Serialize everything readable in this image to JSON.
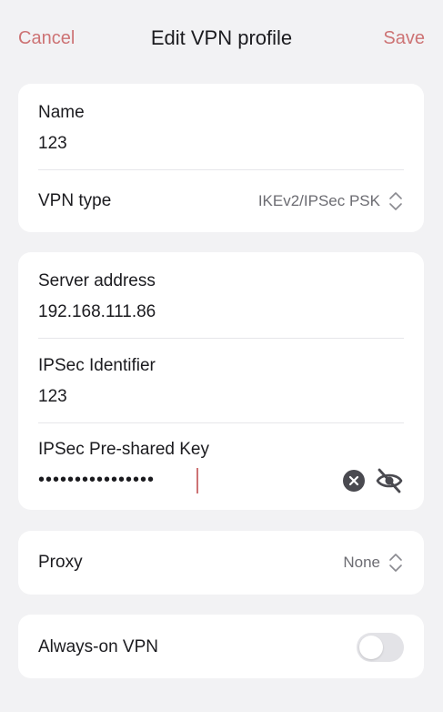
{
  "header": {
    "cancel_label": "Cancel",
    "title": "Edit VPN profile",
    "save_label": "Save"
  },
  "general": {
    "name_label": "Name",
    "name_value": "123",
    "vpn_type_label": "VPN type",
    "vpn_type_value": "IKEv2/IPSec PSK"
  },
  "server": {
    "address_label": "Server address",
    "address_value": "192.168.111.86",
    "identifier_label": "IPSec Identifier",
    "identifier_value": "123",
    "psk_label": "IPSec Pre-shared Key",
    "psk_masked_value": "••••••••••••••••"
  },
  "proxy": {
    "label": "Proxy",
    "value": "None"
  },
  "always_on": {
    "label": "Always-on VPN",
    "enabled": false
  },
  "colors": {
    "accent": "#cd7374",
    "background": "#f2f2f4",
    "card": "#ffffff",
    "secondary_text": "#6c6c72",
    "icon_fill": "#4a4a50"
  },
  "icons": {
    "vpn_type_selector": "chevron-up-down-icon",
    "proxy_selector": "chevron-up-down-icon",
    "psk_clear": "clear-circle-icon",
    "psk_visibility": "eye-off-icon"
  }
}
